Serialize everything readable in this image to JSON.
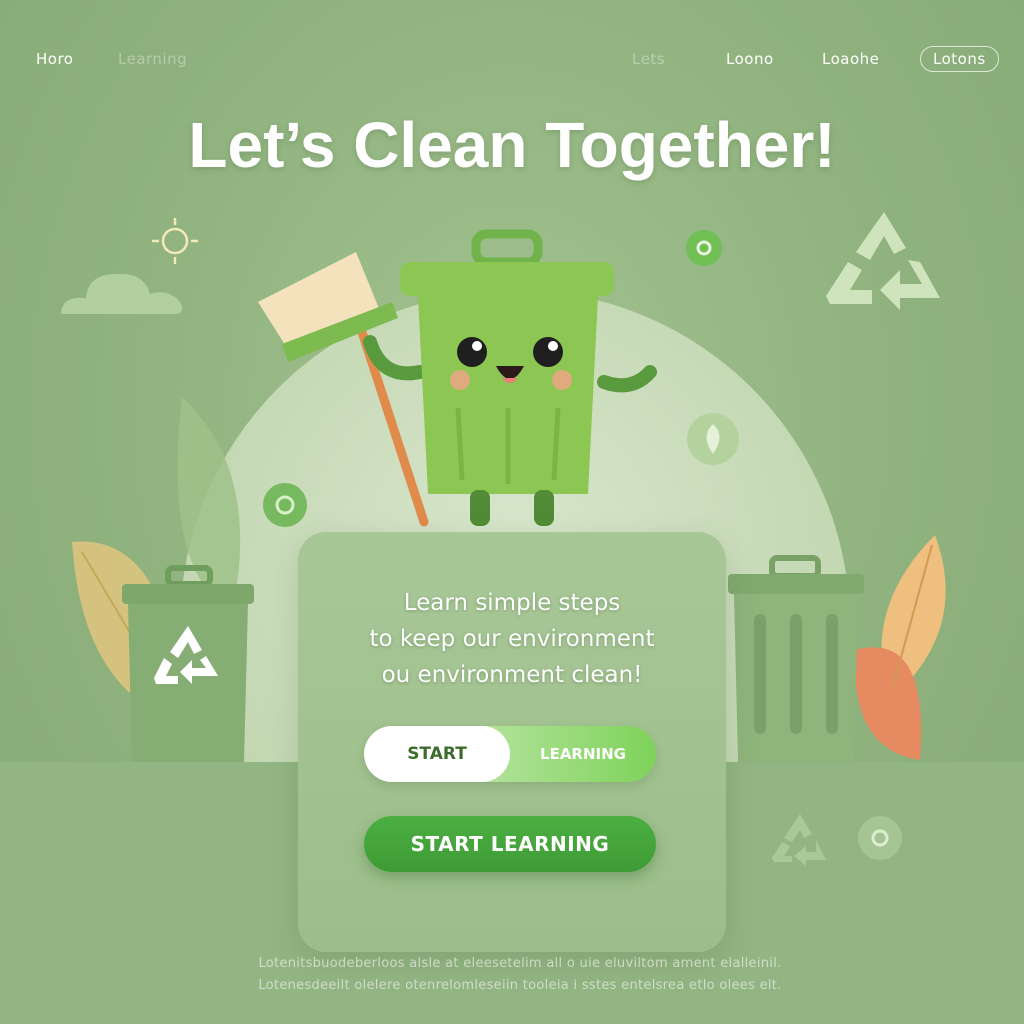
{
  "nav": {
    "left": [
      {
        "label": "Horo",
        "faded": false
      },
      {
        "label": "Learning",
        "faded": true
      }
    ],
    "right": [
      {
        "label": "Lets",
        "faded": true
      },
      {
        "label": "Loono",
        "faded": false
      },
      {
        "label": "Loaohe",
        "faded": false
      },
      {
        "label": "Lotons",
        "faded": false
      }
    ]
  },
  "hero": {
    "title": "Let’s Clean Together!"
  },
  "panel": {
    "text_lines": [
      "Learn simple steps",
      "to keep our environment",
      "ou environment clean!"
    ],
    "toggle": {
      "left_label": "START",
      "right_label": "LEARNING"
    },
    "button": {
      "label": "START LEARNING"
    }
  },
  "footer": {
    "line1": "Lotenitsbuodeberloos alsle at eleesetelim all o uie eluviltom ament elalleinil.",
    "line2": "Lotenesdeeilt olelere otenrelomleseiin tooleia i sstes entelsrea etlo olees elt."
  },
  "icons": [
    "recycle-icon",
    "sun-icon",
    "cloud-icon",
    "leaf-icon",
    "trash-bin-icon",
    "broom-icon"
  ],
  "colors": {
    "background": "#8fb27e",
    "accent_green": "#4caf41",
    "mascot_green": "#8cc653",
    "white": "#ffffff"
  }
}
